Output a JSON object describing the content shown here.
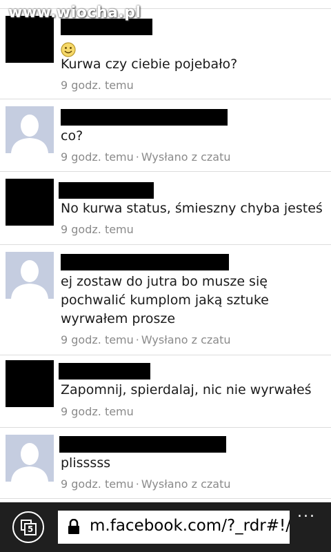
{
  "watermark": "www.wiocha.pl",
  "messages": [
    {
      "avatar": "black",
      "smiley": true,
      "text": "Kurwa czy ciebie pojebało?",
      "time": "9 godz. temu",
      "via": ""
    },
    {
      "avatar": "default",
      "smiley": false,
      "text": "co?",
      "time": "9 godz. temu",
      "via": "Wysłano z czatu"
    },
    {
      "avatar": "black",
      "smiley": false,
      "text": "No kurwa status, śmieszny chyba jesteś",
      "time": "9 godz. temu",
      "via": ""
    },
    {
      "avatar": "default",
      "smiley": false,
      "text_lines": [
        "ej zostaw do jutra bo musze się",
        "pochwalić kumplom jaką sztuke",
        "wyrwałem prosze"
      ],
      "time": "9 godz. temu",
      "via": "Wysłano z czatu"
    },
    {
      "avatar": "black",
      "smiley": false,
      "text": "Zapomnij, spierdalaj, nic nie wyrwałeś",
      "time": "9 godz. temu",
      "via": ""
    },
    {
      "avatar": "default",
      "smiley": false,
      "text": "plisssss",
      "time": "9 godz. temu",
      "via": "Wysłano z czatu"
    }
  ],
  "browser": {
    "tab_count": "5",
    "url": "m.facebook.com/?_rdr#!/",
    "more_label": "...",
    "colors": {
      "bar": "#1f1f1f",
      "address": "#ffffff"
    }
  },
  "colors": {
    "default_avatar": "#c5cde0",
    "meta": "#8a8a8a",
    "text": "#1a1a1a"
  }
}
